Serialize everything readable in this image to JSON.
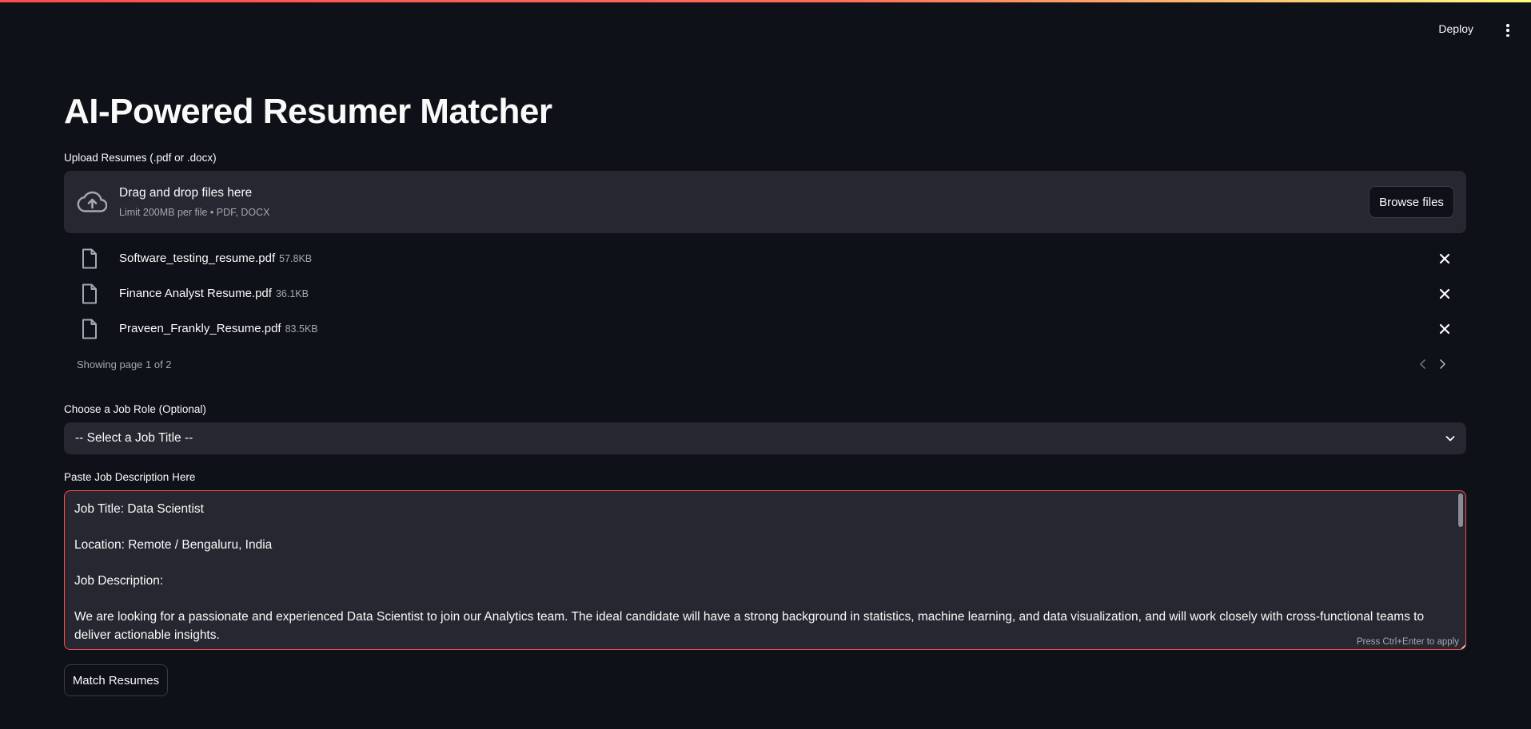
{
  "header": {
    "deploy_label": "Deploy",
    "menu_icon": "kebab-menu-icon"
  },
  "page": {
    "title": "AI-Powered Resumer Matcher"
  },
  "uploader": {
    "label": "Upload Resumes (.pdf or .docx)",
    "dropzone_title": "Drag and drop files here",
    "dropzone_limit": "Limit 200MB per file • PDF, DOCX",
    "browse_label": "Browse files",
    "icon": "cloud-upload-icon",
    "files": [
      {
        "name": "Software_testing_resume.pdf",
        "size": "57.8KB"
      },
      {
        "name": "Finance Analyst Resume.pdf",
        "size": "36.1KB"
      },
      {
        "name": "Praveen_Frankly_Resume.pdf",
        "size": "83.5KB"
      }
    ],
    "pager_text": "Showing page 1 of 2"
  },
  "job_role": {
    "label": "Choose a Job Role (Optional)",
    "selected": "-- Select a Job Title --"
  },
  "job_description": {
    "label": "Paste Job Description Here",
    "value": "Job Title: Data Scientist\n\nLocation: Remote / Bengaluru, India\n\nJob Description:\n\nWe are looking for a passionate and experienced Data Scientist to join our Analytics team. The ideal candidate will have a strong background in statistics, machine learning, and data visualization, and will work closely with cross-functional teams to deliver actionable insights.",
    "hint": "Press Ctrl+Enter to apply"
  },
  "actions": {
    "match_label": "Match Resumes"
  },
  "colors": {
    "background": "#0e1117",
    "widget_bg": "#262730",
    "accent": "#ff4b4b",
    "text": "#fafafa",
    "muted": "#a3a8b4"
  }
}
